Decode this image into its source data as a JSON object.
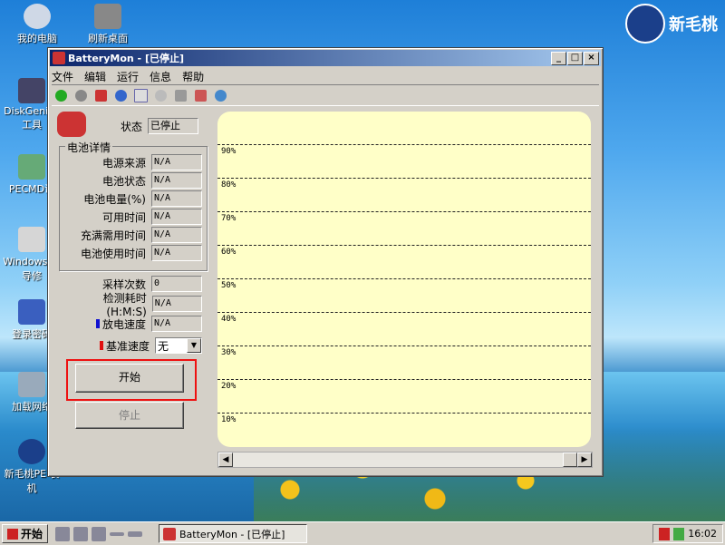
{
  "desktop": {
    "icons": [
      {
        "label": "我的电脑"
      },
      {
        "label": "刷新桌面"
      },
      {
        "label": "DiskGenius 工具"
      },
      {
        "label": "PECMD说"
      },
      {
        "label": "Windows 引导修"
      },
      {
        "label": "登录密码"
      },
      {
        "label": "加载网络"
      },
      {
        "label": "新毛桃PE 装机"
      }
    ],
    "brand": "新毛桃"
  },
  "window": {
    "title": "BatteryMon - [已停止]",
    "menu": [
      "文件",
      "编辑",
      "运行",
      "信息",
      "帮助"
    ],
    "toolbar_icons": [
      "check-icon",
      "circle-icon",
      "battery-icon",
      "info-icon",
      "checklist-icon",
      "gauge-icon",
      "tools-icon",
      "battery-settings-icon",
      "help-icon"
    ],
    "status_label": "状态",
    "status_value": "已停止",
    "details_group": "电池详情",
    "details": [
      {
        "label": "电源来源",
        "value": "N/A"
      },
      {
        "label": "电池状态",
        "value": "N/A"
      },
      {
        "label": "电池电量(%)",
        "value": "N/A"
      },
      {
        "label": "可用时间",
        "value": "N/A"
      },
      {
        "label": "充满需用时间",
        "value": "N/A"
      },
      {
        "label": "电池使用时间",
        "value": "N/A"
      }
    ],
    "sample_count_label": "采样次数",
    "sample_count_value": "0",
    "elapsed_label": "检测耗时 (H:M:S)",
    "elapsed_value": "N/A",
    "discharge_label": "放电速度",
    "discharge_value": "N/A",
    "baseline_label": "基准速度",
    "baseline_value": "无",
    "start_button": "开始",
    "stop_button": "停止",
    "colors": {
      "discharge": "#1010d0",
      "baseline": "#e01010",
      "chart_bg": "#ffffc8"
    }
  },
  "chart_data": {
    "type": "line",
    "title": "",
    "xlabel": "",
    "ylabel": "",
    "ytick_labels": [
      "90%",
      "80%",
      "70%",
      "60%",
      "50%",
      "40%",
      "30%",
      "20%",
      "10%"
    ],
    "ylim": [
      0,
      100
    ],
    "series": []
  },
  "taskbar": {
    "start_label": "开始",
    "task_label": "BatteryMon - [已停止]",
    "clock": "16:02"
  }
}
